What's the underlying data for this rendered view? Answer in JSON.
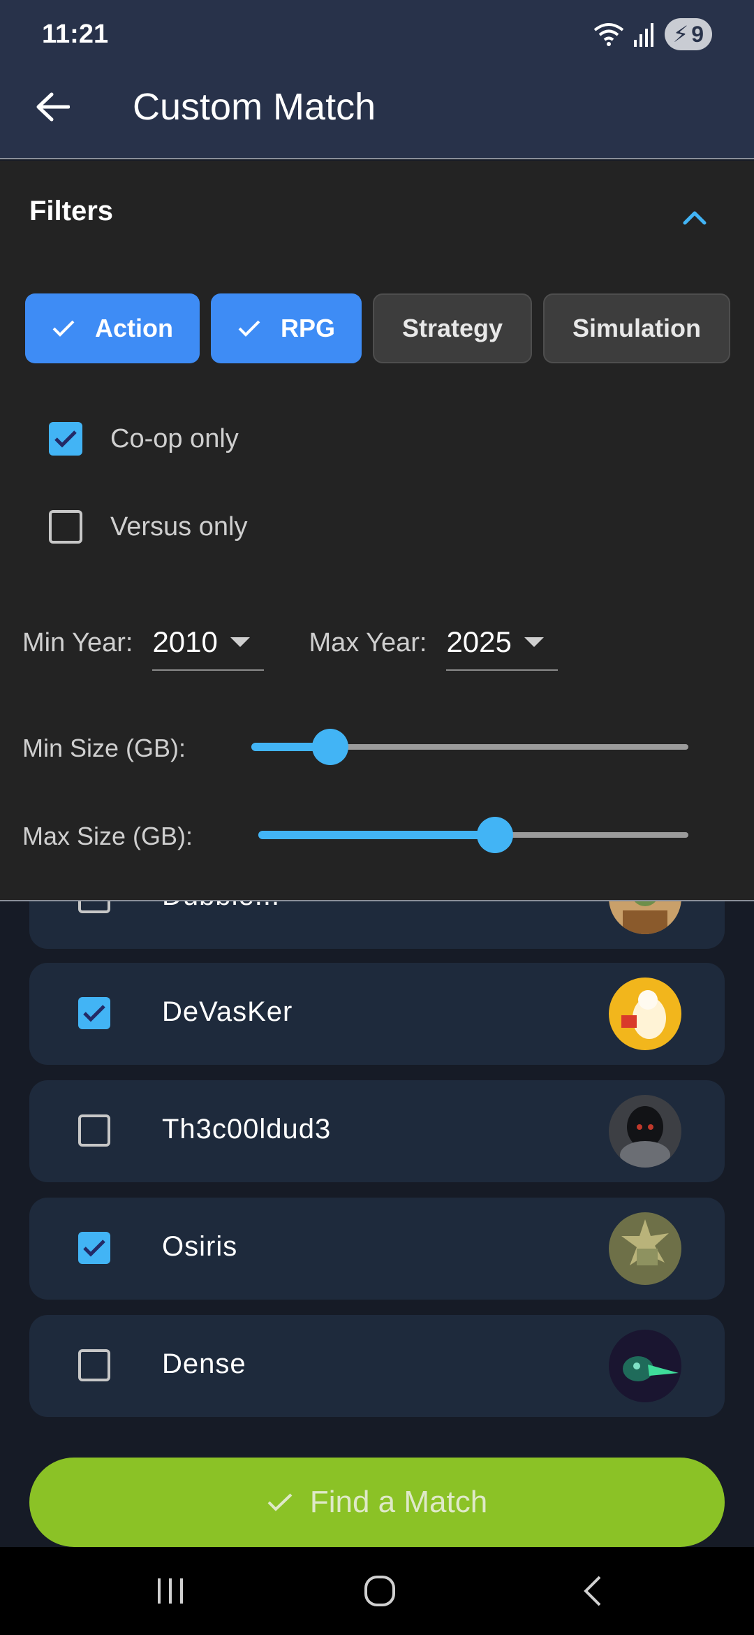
{
  "status_bar": {
    "time": "11:21",
    "battery": "9"
  },
  "app_bar": {
    "title": "Custom Match"
  },
  "filters": {
    "title": "Filters",
    "genres": [
      {
        "label": "Action",
        "selected": true
      },
      {
        "label": "RPG",
        "selected": true
      },
      {
        "label": "Strategy",
        "selected": false
      },
      {
        "label": "Simulation",
        "selected": false
      }
    ],
    "coop": {
      "label": "Co-op only",
      "checked": true
    },
    "versus": {
      "label": "Versus only",
      "checked": false
    },
    "min_year": {
      "label": "Min Year:",
      "value": "2010"
    },
    "max_year": {
      "label": "Max Year:",
      "value": "2025"
    },
    "min_size": {
      "label": "Min Size (GB):",
      "fraction": 0.18
    },
    "max_size": {
      "label": "Max Size (GB):",
      "fraction": 0.55
    }
  },
  "players": [
    {
      "name": "Dubble...",
      "checked": false
    },
    {
      "name": "DeVasKer",
      "checked": true
    },
    {
      "name": "Th3c00ldud3",
      "checked": false
    },
    {
      "name": "Osiris",
      "checked": true
    },
    {
      "name": "Dense",
      "checked": false
    }
  ],
  "find_button": {
    "label": "Find a Match"
  },
  "colors": {
    "accent": "#42b4f5",
    "chip_selected": "#3e8cf5",
    "find_button": "#8bc226",
    "app_bar": "#28324a"
  }
}
